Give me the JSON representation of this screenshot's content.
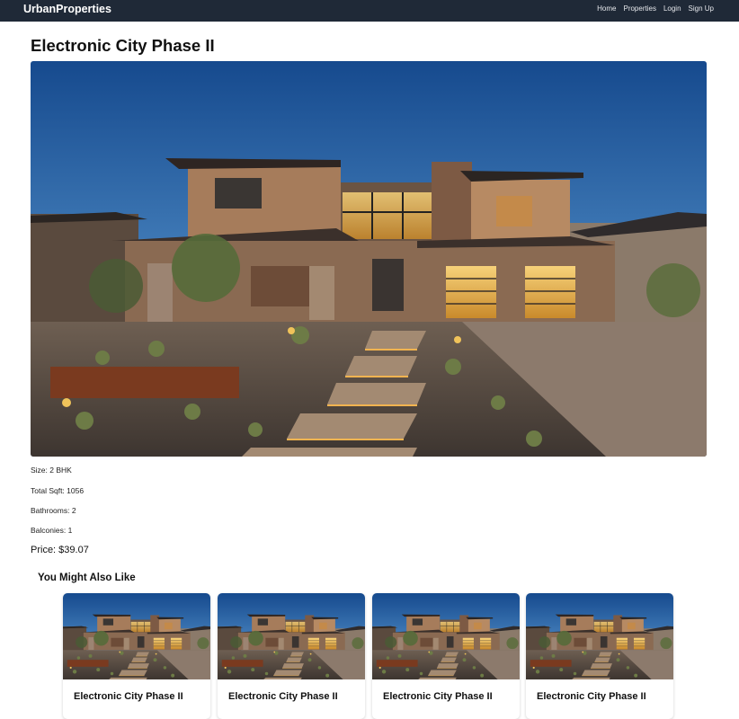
{
  "nav": {
    "brand": "UrbanProperties",
    "links": [
      "Home",
      "Properties",
      "Login",
      "Sign Up"
    ]
  },
  "property": {
    "title": "Electronic City Phase II",
    "size": "Size: 2 BHK",
    "sqft": "Total Sqft: 1056",
    "bathrooms": "Bathrooms: 2",
    "balconies": "Balconies: 1",
    "price": "Price: $39.07"
  },
  "related": {
    "heading": "You Might Also Like",
    "cards": [
      {
        "title": "Electronic City Phase II"
      },
      {
        "title": "Electronic City Phase II"
      },
      {
        "title": "Electronic City Phase II"
      },
      {
        "title": "Electronic City Phase II"
      }
    ]
  }
}
